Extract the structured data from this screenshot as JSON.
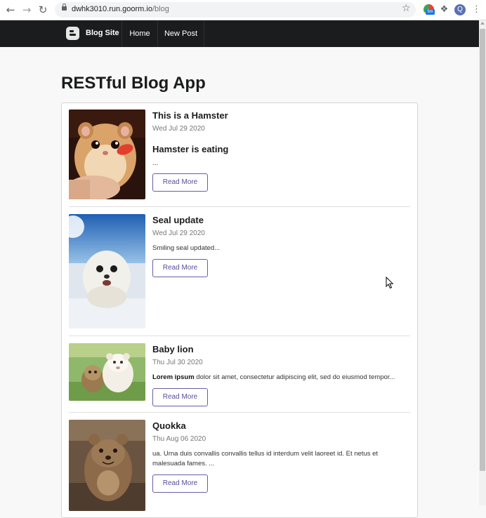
{
  "browser": {
    "url_host": "dwhk3010.run.goorm.io",
    "url_path": "/blog",
    "profile_initial": "Q",
    "extension_badge": "5m",
    "icons": [
      "back-icon",
      "forward-icon",
      "reload-icon",
      "lock-icon",
      "star-icon",
      "extensions-icon",
      "menu-icon"
    ]
  },
  "navbar": {
    "brand": "Blog Site",
    "items": [
      {
        "label": "Home"
      },
      {
        "label": "New Post"
      }
    ]
  },
  "page": {
    "title": "RESTful Blog App"
  },
  "posts": [
    {
      "title": "This is a Hamster",
      "date": "Wed Jul 29 2020",
      "subheading": "Hamster is eating",
      "excerpt": "...",
      "button": "Read More"
    },
    {
      "title": "Seal update",
      "date": "Wed Jul 29 2020",
      "excerpt": "Smiling seal updated...",
      "button": "Read More"
    },
    {
      "title": "Baby lion",
      "date": "Thu Jul 30 2020",
      "excerpt_bold": "Lorem ipsum",
      "excerpt": " dolor sit amet, consectetur adipiscing elit, sed do eiusmod tempor...",
      "button": "Read More"
    },
    {
      "title": "Quokka",
      "date": "Thu Aug 06 2020",
      "excerpt": "ua. Urna duis convallis convallis tellus id interdum velit laoreet id. Et netus et malesuada fames. ...",
      "button": "Read More"
    }
  ],
  "colors": {
    "navbar_bg": "#1b1c1d",
    "button_border": "#6c5ca8",
    "button_text": "#5b4c9b",
    "page_bg": "#f8f8f8"
  }
}
